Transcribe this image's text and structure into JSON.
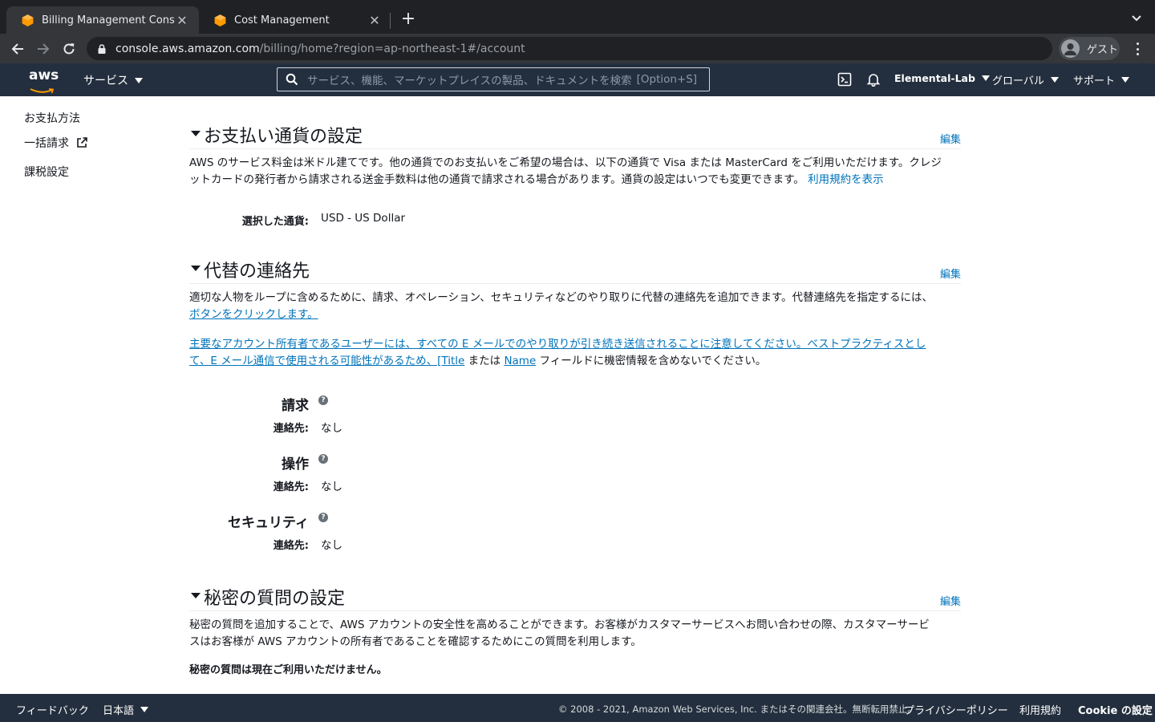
{
  "browser": {
    "tabs": [
      {
        "title": "Billing Management Console",
        "active": true
      },
      {
        "title": "Cost Management",
        "active": false
      }
    ],
    "url_host": "console.aws.amazon.com",
    "url_path": "/billing/home?region=ap-northeast-1#/account",
    "profile_label": "ゲスト",
    "colors": {
      "tabstrip": "#202124",
      "toolbar": "#35363a",
      "favicon": "#ff9900"
    }
  },
  "awsnav": {
    "logo": "aws",
    "services_label": "サービス",
    "search_placeholder": "サービス、機能、マーケットプレイスの製品、ドキュメントを検索",
    "search_shortcut": "[Option+S]",
    "account_label": "Elemental-Lab",
    "region_label": "グローバル",
    "support_label": "サポート",
    "colors": {
      "bg": "#232f3e",
      "link": "#0073bb"
    }
  },
  "sidebar": {
    "items": [
      {
        "label": "お支払方法",
        "external": false
      },
      {
        "label": "一括請求",
        "external": true
      },
      {
        "label": "課税設定",
        "external": false
      }
    ]
  },
  "sections": {
    "currency": {
      "title": "お支払い通貨の設定",
      "edit_label": "編集",
      "desc_line1": "AWS のサービス料金は米ドル建てです。他の通貨でのお支払いをご希望の場合は、以下の通貨で Visa または MasterCard をご利用いただけます。クレジ",
      "desc_line2": "ットカードの発行者から請求される送金手数料は他の通貨で請求される場合があります。通貨の設定はいつでも変更できます。",
      "terms_link": "利用規約を表示",
      "selected_label": "選択した通貨:",
      "selected_value": "USD - US Dollar"
    },
    "alternate": {
      "title": "代替の連絡先",
      "edit_label": "編集",
      "desc_line1": "適切な人物をループに含めるために、請求、オペレーション、セキュリティなどのやり取りに代替の連絡先を追加できます。代替連絡先を指定するには、",
      "desc_link": "ボタンをクリックします。",
      "note_line1": "主要なアカウント所有者であるユーザーには、すべての E メールでのやり取りが引き続き送信されることに注意してください。ベストプラクティスとし",
      "note_line2_link": "て、E メール通信で使用される可能性があるため、[Title",
      "note_mid1": " または ",
      "note_name_link": "Name",
      "note_tail": " フィールドに機密情報を含めないでください。",
      "contacts": [
        {
          "heading": "請求",
          "label": "連絡先:",
          "value": "なし"
        },
        {
          "heading": "操作",
          "label": "連絡先:",
          "value": "なし"
        },
        {
          "heading": "セキュリティ",
          "label": "連絡先:",
          "value": "なし"
        }
      ]
    },
    "security_questions": {
      "title": "秘密の質問の設定",
      "edit_label": "編集",
      "desc_line1": "秘密の質問を追加することで、AWS アカウントの安全性を高めることができます。お客様がカスタマーサービスへお問い合わせの際、カスタマーサービ",
      "desc_line2": "スはお客様が AWS アカウントの所有者であることを確認するためにこの質問を利用します。",
      "status": "秘密の質問は現在ご利用いただけません。"
    }
  },
  "footer": {
    "feedback": "フィードバック",
    "language": "日本語",
    "copyright": "© 2008 - 2021, Amazon Web Services, Inc. またはその関連会社。無断転用禁止。",
    "privacy": "プライバシーポリシー",
    "terms": "利用規約",
    "cookie": "Cookie の設定"
  }
}
